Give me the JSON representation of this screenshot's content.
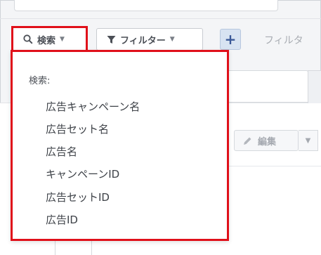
{
  "toolbar": {
    "search_label": "検索",
    "filter_label": "フィルター",
    "add_label": "+",
    "filter_hint": "フィルタ"
  },
  "search_dropdown": {
    "header": "検索:",
    "items": [
      {
        "label": "広告キャンペーン名"
      },
      {
        "label": "広告セット名"
      },
      {
        "label": "広告名"
      },
      {
        "label": "キャンペーンID"
      },
      {
        "label": "広告セットID"
      },
      {
        "label": "広告ID"
      }
    ]
  },
  "background": {
    "edit_label": "編集"
  },
  "colors": {
    "highlight": "#e0101a",
    "accent": "#3b5998"
  }
}
